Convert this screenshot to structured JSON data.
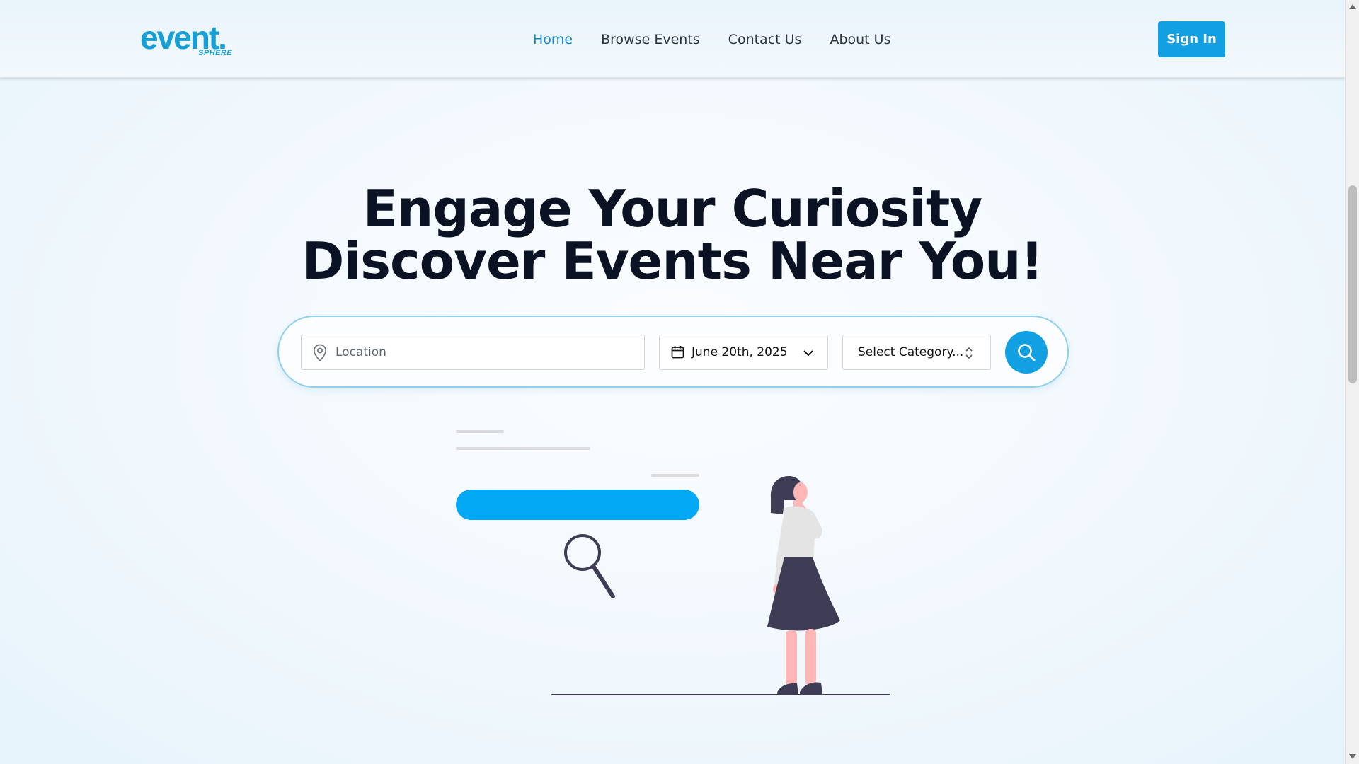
{
  "header": {
    "logo": {
      "main": "event.",
      "sub": "SPHERE"
    },
    "nav": [
      {
        "label": "Home",
        "active": true
      },
      {
        "label": "Browse Events",
        "active": false
      },
      {
        "label": "Contact Us",
        "active": false
      },
      {
        "label": "About Us",
        "active": false
      }
    ],
    "sign_in_label": "Sign In"
  },
  "hero": {
    "title_line1": "Engage Your Curiosity",
    "title_line2": "Discover Events Near You!"
  },
  "search": {
    "location_placeholder": "Location",
    "location_value": "",
    "date_value": "June 20th, 2025",
    "category_value": "Select Category..."
  },
  "icons": {
    "location": "map-pin-icon",
    "date": "calendar-icon",
    "date_toggle": "chevron-down-icon",
    "category_toggle": "chevron-up-down-icon",
    "search": "search-icon"
  },
  "colors": {
    "accent": "#12a0e3",
    "nav_active": "#1786c9",
    "title": "#0a1224",
    "illustration_bar": "#03a9f4",
    "illustration_dark": "#3f3d56",
    "illustration_skin": "#ffb6b6"
  }
}
